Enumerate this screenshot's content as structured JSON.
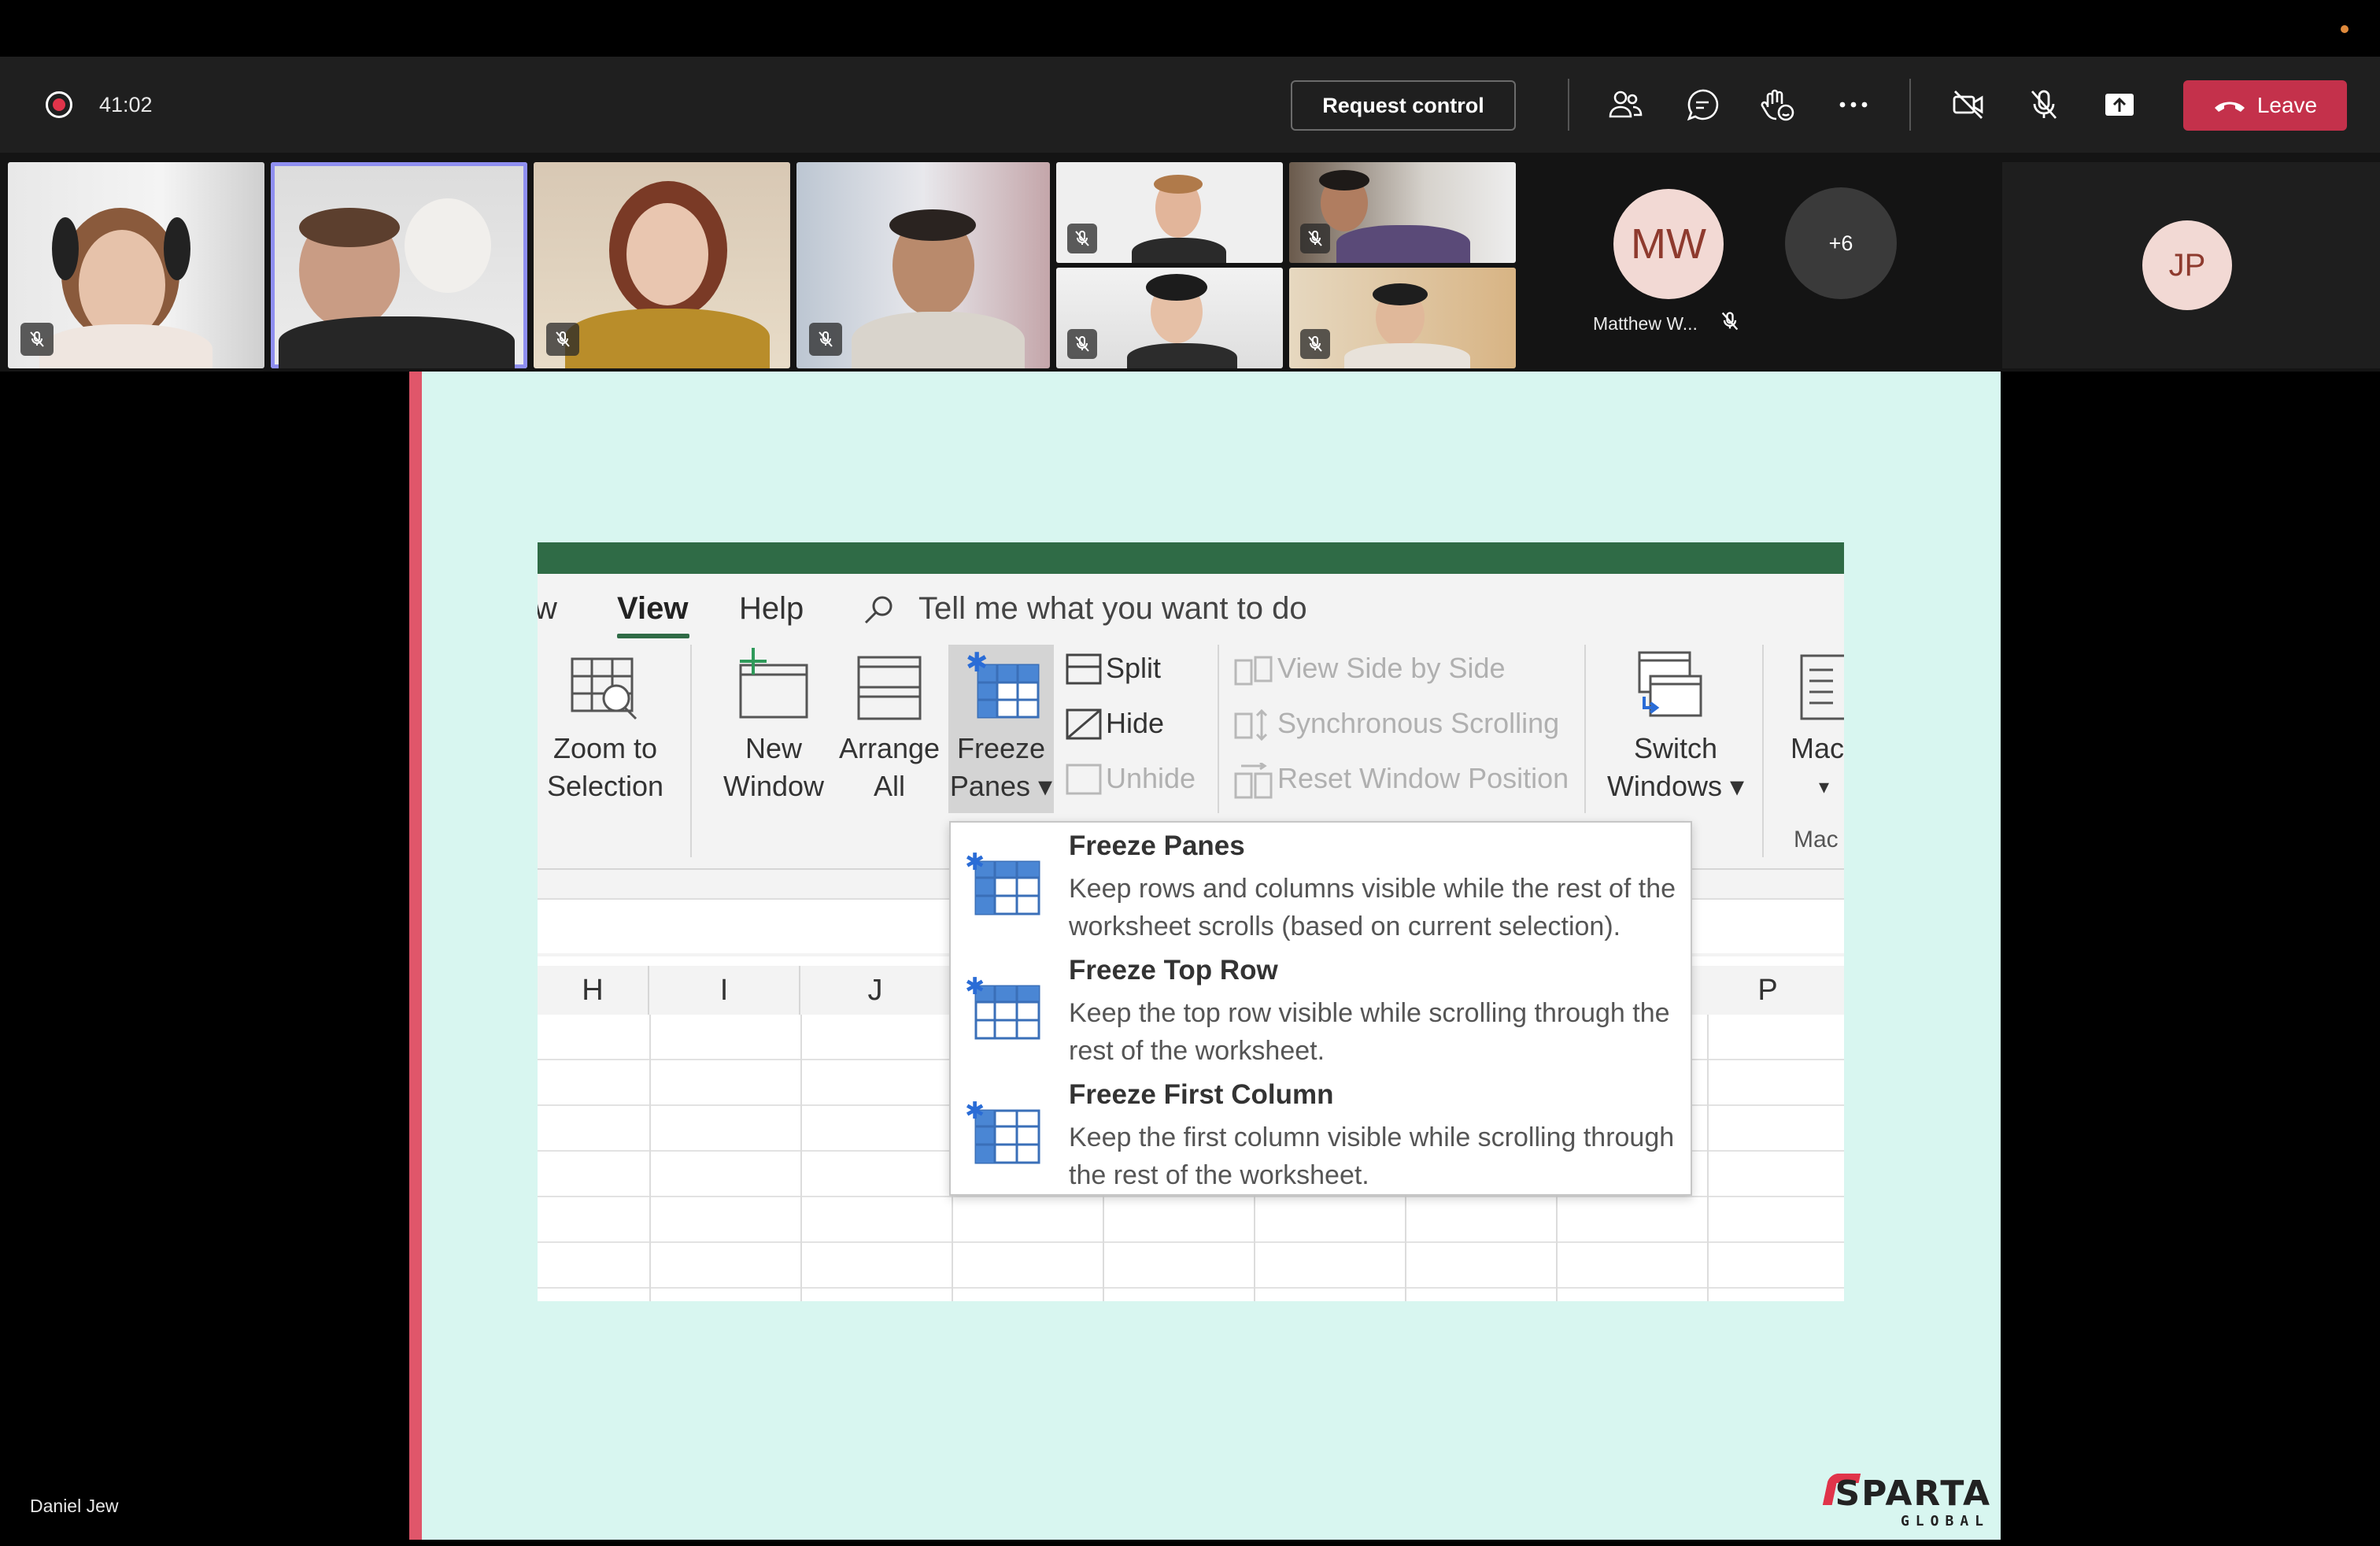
{
  "meeting": {
    "timer": "41:02",
    "request_control_label": "Request control",
    "leave_label": "Leave",
    "presenter_name": "Daniel Jew"
  },
  "participants": {
    "matthew_initials": "MW",
    "matthew_name": "Matthew W...",
    "overflow_count": "+6",
    "jp_initials": "JP"
  },
  "excel": {
    "tabs": [
      "w",
      "View",
      "Help"
    ],
    "active_tab": "View",
    "tell_me": "Tell me what you want to do",
    "ribbon": {
      "zoom_line1": "Zoom to",
      "zoom_line2": "Selection",
      "new_window_line1": "New",
      "new_window_line2": "Window",
      "arrange_line1": "Arrange",
      "arrange_line2": "All",
      "freeze_line1": "Freeze",
      "freeze_line2": "Panes ▾",
      "split": "Split",
      "hide": "Hide",
      "unhide": "Unhide",
      "view_side": "View Side by Side",
      "sync_scroll": "Synchronous Scrolling",
      "reset_window": "Reset Window Position",
      "switch_line1": "Switch",
      "switch_line2": "Windows ▾",
      "macros_label": "Mac",
      "macros_arrow": "▾",
      "macros_group": "Mac"
    },
    "columns": [
      "H",
      "I",
      "J",
      "P"
    ],
    "freeze_menu": [
      {
        "title": "Freeze Panes",
        "desc": "Keep rows and columns visible while the rest of the worksheet scrolls (based on current selection)."
      },
      {
        "title": "Freeze Top Row",
        "desc": "Keep the top row visible while scrolling through the rest of the worksheet."
      },
      {
        "title": "Freeze First Column",
        "desc": "Keep the first column visible while scrolling through the rest of the worksheet."
      }
    ]
  },
  "brand": {
    "logo_main": "SPARTA",
    "logo_sub": "GLOBAL"
  },
  "colors": {
    "leave": "#c4314b",
    "slide_bg": "#d8f6f0",
    "slide_accent": "#e0566a",
    "excel_green": "#2f6b46",
    "active_tile": "#8f8ff0"
  }
}
